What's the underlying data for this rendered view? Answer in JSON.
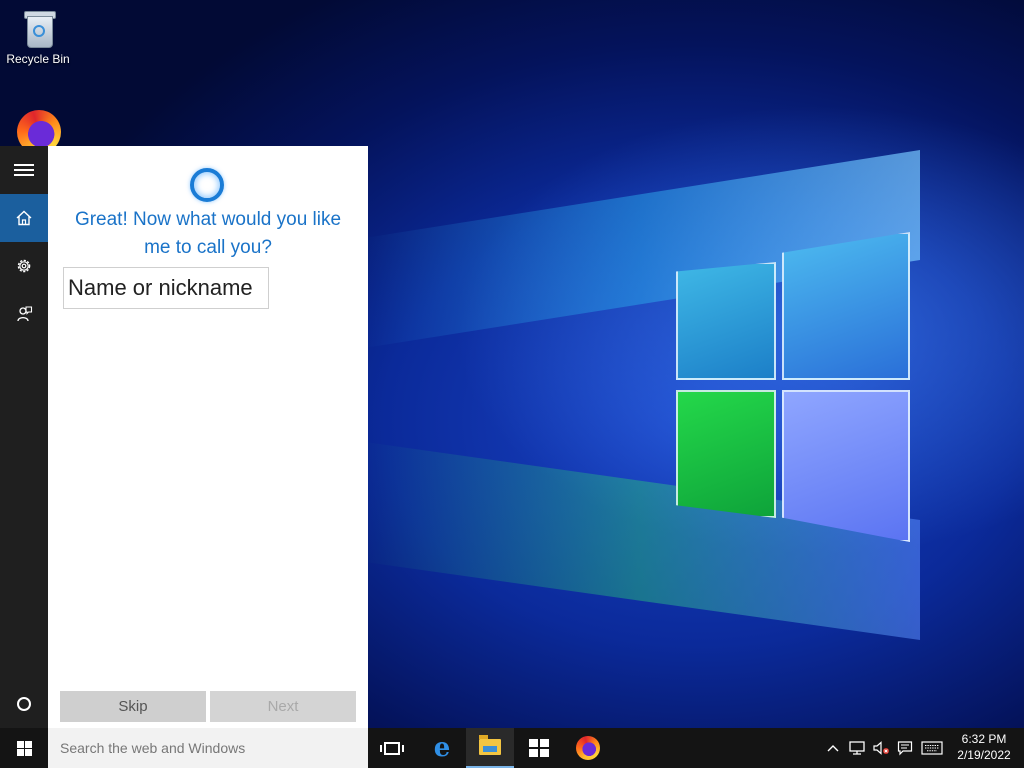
{
  "desktop": {
    "icons": [
      {
        "label": "Recycle Bin",
        "icon": "recycle-bin-icon"
      },
      {
        "label": "",
        "icon": "firefox-icon"
      }
    ]
  },
  "cortana": {
    "rail": [
      "menu-icon",
      "home-icon",
      "settings-icon",
      "feedback-icon",
      "cortana-circle-icon"
    ],
    "question": "Great! Now what would you like me to call you?",
    "name_placeholder": "Name or nickname",
    "skip_label": "Skip",
    "next_label": "Next",
    "accent": "#1a73c8"
  },
  "taskbar": {
    "search_placeholder": "Search the web and Windows",
    "pinned": [
      "task-view-icon",
      "edge-icon",
      "file-explorer-icon",
      "store-icon",
      "firefox-icon"
    ],
    "tray": [
      "chevron-up-icon",
      "network-icon",
      "volume-muted-icon",
      "action-center-icon",
      "keyboard-icon"
    ],
    "time": "6:32 PM",
    "date": "2/19/2022"
  }
}
